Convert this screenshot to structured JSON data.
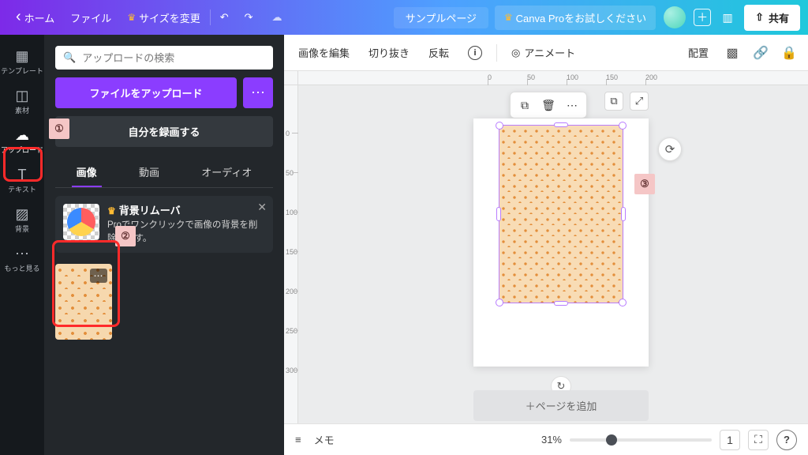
{
  "header": {
    "home": "ホーム",
    "file": "ファイル",
    "resize": "サイズを変更",
    "doc_title": "サンプルページ",
    "pro_cta": "Canva Proをお試しください",
    "share": "共有"
  },
  "rail": {
    "template": "テンプレート",
    "elements": "素材",
    "upload": "アップロード",
    "text": "テキスト",
    "background": "背景",
    "more": "もっと見る"
  },
  "side": {
    "search_placeholder": "アップロードの検索",
    "upload_btn": "ファイルをアップロード",
    "record_btn": "自分を録画する",
    "tab_image": "画像",
    "tab_video": "動画",
    "tab_audio": "オーディオ",
    "promo_title": "背景リムーバ",
    "promo_body": "Proでワンクリックで画像の背景を削除します。"
  },
  "ctx": {
    "edit_image": "画像を編集",
    "crop": "切り抜き",
    "flip": "反転",
    "animate": "アニメート",
    "position": "配置"
  },
  "canvas": {
    "add_page": "＋ページを追加"
  },
  "annotations": {
    "a1": "①",
    "a2": "②",
    "a3": "③"
  },
  "ruler": {
    "h": [
      "0",
      "50",
      "100",
      "150",
      "200"
    ],
    "v": [
      "0",
      "50",
      "100",
      "150",
      "200",
      "250",
      "300"
    ]
  },
  "footer": {
    "notes": "メモ",
    "zoom": "31%",
    "page_count": "1"
  }
}
